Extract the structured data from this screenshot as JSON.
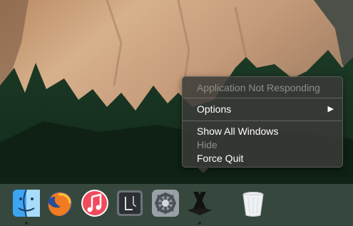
{
  "context_menu": {
    "title": "Application Not Responding",
    "items": [
      {
        "label": "Options",
        "submenu_arrow": "▶",
        "enabled": true
      },
      {
        "label": "Show All Windows",
        "enabled": true
      },
      {
        "label": "Hide",
        "enabled": false
      },
      {
        "label": "Force Quit",
        "enabled": true
      }
    ]
  },
  "dock": {
    "apps": [
      {
        "name": "Finder",
        "icon": "finder-icon",
        "running": true
      },
      {
        "name": "Firefox",
        "icon": "firefox-icon",
        "running": false
      },
      {
        "name": "iTunes",
        "icon": "itunes-icon",
        "running": false
      },
      {
        "name": "Logic Pro X",
        "icon": "logic-pro-icon",
        "running": false
      },
      {
        "name": "System Preferences",
        "icon": "system-preferences-icon",
        "running": false
      },
      {
        "name": "X11 / XQuartz",
        "icon": "xquartz-icon",
        "running": true
      },
      {
        "name": "Trash",
        "icon": "trash-icon",
        "running": false
      }
    ]
  }
}
